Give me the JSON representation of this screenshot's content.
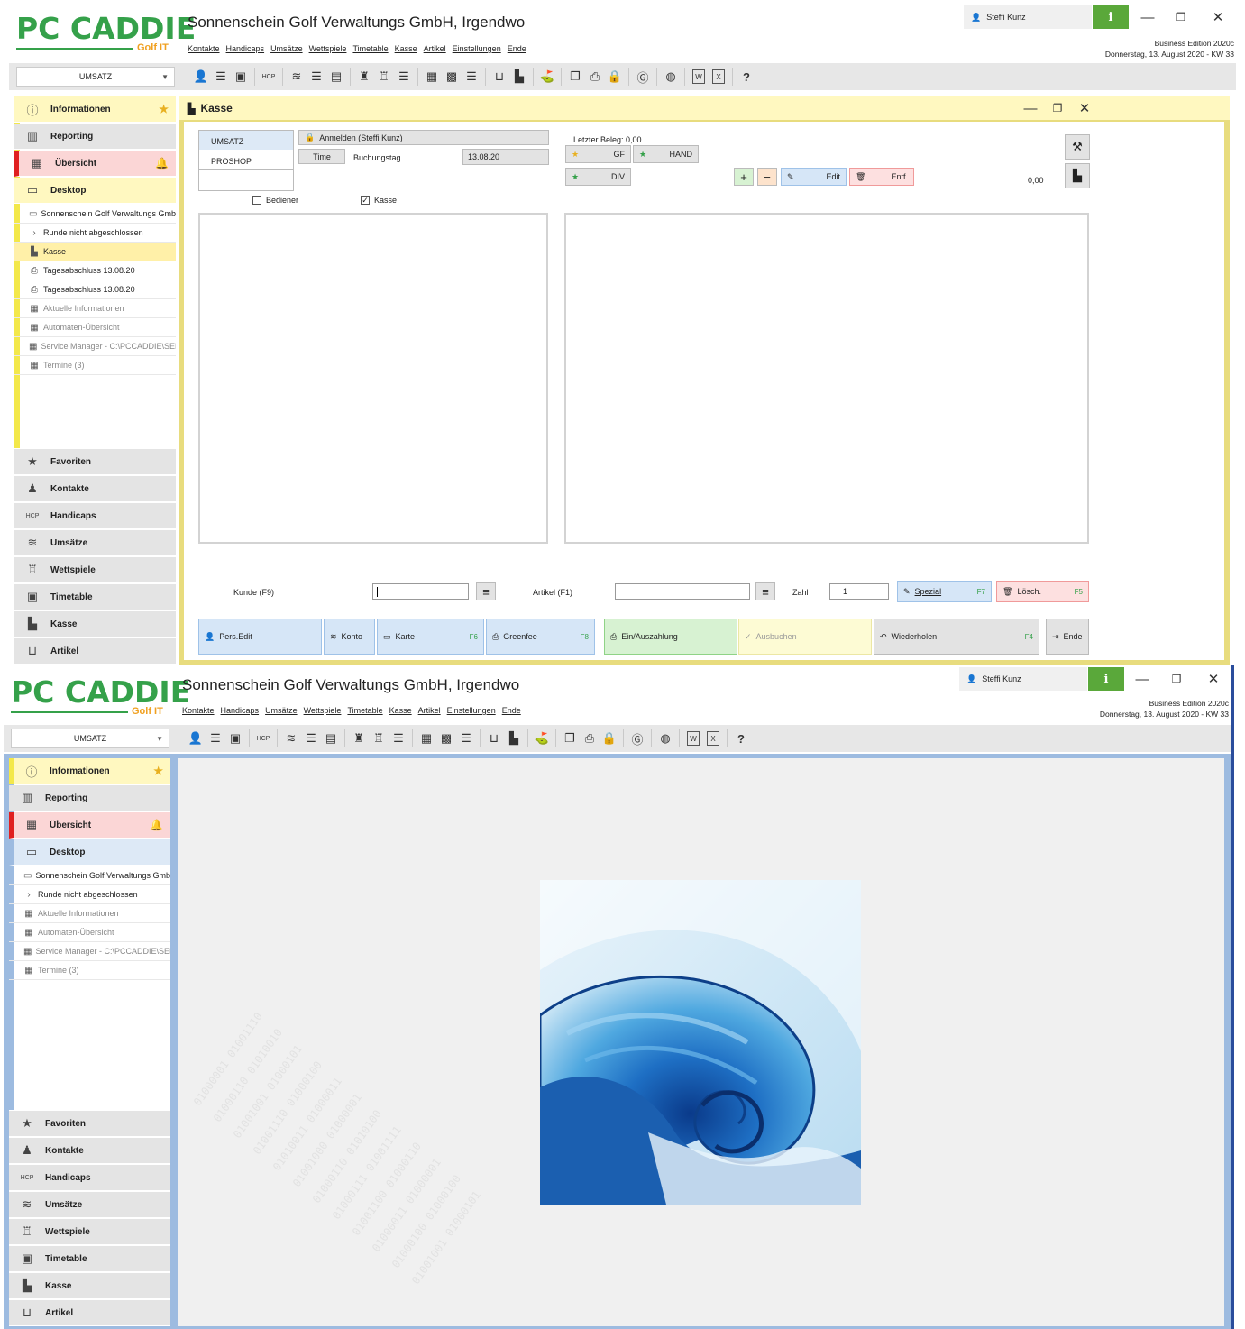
{
  "header": {
    "logo": "PC CADDIE",
    "logo_sub": "Golf IT",
    "title": "Sonnenschein Golf Verwaltungs GmbH, Irgendwo",
    "menu": [
      "Kontakte",
      "Handicaps",
      "Umsätze",
      "Wettspiele",
      "Timetable",
      "Kasse",
      "Artikel",
      "Einstellungen",
      "Ende"
    ],
    "user": "Steffi Kunz",
    "info_icon": "i",
    "edition": "Business Edition 2020c",
    "date": "Donnerstag, 13. August 2020 - KW 33",
    "window_controls": [
      "minimize-icon",
      "restore-icon",
      "close-icon"
    ]
  },
  "toolbar": {
    "combo_value": "UMSATZ",
    "icons": [
      "contact-icon",
      "list-icon",
      "card-icon",
      "sep",
      "hcp-icon",
      "sep",
      "coins-icon",
      "list-icon",
      "document-icon",
      "sep",
      "trophy-icon",
      "trophy-alt-icon",
      "list-icon",
      "sep",
      "calendar-icon",
      "calendar-person-icon",
      "list-icon",
      "sep",
      "cart-icon",
      "register-icon",
      "sep",
      "tee-icon",
      "sep",
      "window-icon",
      "print-icon",
      "lock-icon",
      "sep",
      "g-circle-icon",
      "sep",
      "globe-icon",
      "sep",
      "word-icon",
      "excel-icon",
      "sep",
      "help-icon"
    ]
  },
  "sidebar": {
    "top": [
      {
        "label": "Informationen",
        "icon": "ⓘ"
      },
      {
        "label": "Reporting",
        "icon": "▥"
      },
      {
        "label": "Übersicht",
        "icon": "▦"
      },
      {
        "label": "Desktop",
        "icon": "▭"
      }
    ],
    "sub_screen1": [
      {
        "label": "Sonnenschein Golf Verwaltungs GmbH",
        "icon": "▭"
      },
      {
        "label": "Runde nicht abgeschlossen",
        "icon": "›"
      },
      {
        "label": "Kasse",
        "icon": "▙"
      },
      {
        "label": "Tagesabschluss 13.08.20",
        "icon": "⎙"
      },
      {
        "label": "Tagesabschluss 13.08.20",
        "icon": "⎙"
      },
      {
        "label": "Aktuelle Informationen",
        "icon": "▦"
      },
      {
        "label": "Automaten-Übersicht",
        "icon": "▦"
      },
      {
        "label": "Service Manager - C:\\PCCADDIE\\SERVICE",
        "icon": "▦"
      },
      {
        "label": "Termine (3)",
        "icon": "▦"
      }
    ],
    "sub_screen2": [
      {
        "label": "Sonnenschein Golf Verwaltungs GmbH",
        "icon": "▭"
      },
      {
        "label": "Runde nicht abgeschlossen",
        "icon": "›"
      },
      {
        "label": "Aktuelle Informationen",
        "icon": "▦"
      },
      {
        "label": "Automaten-Übersicht",
        "icon": "▦"
      },
      {
        "label": "Service Manager - C:\\PCCADDIE\\SERVICE",
        "icon": "▦"
      },
      {
        "label": "Termine (3)",
        "icon": "▦"
      }
    ],
    "bottom": [
      {
        "label": "Favoriten",
        "icon": "★"
      },
      {
        "label": "Kontakte",
        "icon": "♟"
      },
      {
        "label": "Handicaps",
        "icon": "HCP"
      },
      {
        "label": "Umsätze",
        "icon": "≋"
      },
      {
        "label": "Wettspiele",
        "icon": "♖"
      },
      {
        "label": "Timetable",
        "icon": "▣"
      },
      {
        "label": "Kasse",
        "icon": "▙"
      },
      {
        "label": "Artikel",
        "icon": "⊔"
      }
    ]
  },
  "kasse": {
    "title": "Kasse",
    "tabs": [
      "UMSATZ",
      "PROSHOP"
    ],
    "login": "Anmelden (Steffi Kunz)",
    "time_label": "Time",
    "buchungstag_label": "Buchungstag",
    "buchungstag_value": "13.08.20",
    "bediener_label": "Bediener",
    "kasse_check_label": "Kasse",
    "letzter_beleg": "Letzter Beleg: 0,00",
    "quick": [
      "GF",
      "HAND",
      "DIV"
    ],
    "edit_label": "Edit",
    "entf_label": "Entf.",
    "amount": "0,00",
    "kunde_label": "Kunde (F9)",
    "artikel_label": "Artikel (F1)",
    "zahl_label": "Zahl",
    "zahl_value": "1",
    "spezial_label": "Spezial",
    "spezial_key": "F7",
    "losch_label": "Lösch.",
    "losch_key": "F5",
    "bottom_buttons": {
      "pers_edit": "Pers.Edit",
      "konto": "Konto",
      "karte": "Karte",
      "karte_key": "F6",
      "greenfee": "Greenfee",
      "greenfee_key": "F8",
      "ein_aus": "Ein/Auszahlung",
      "ausbuchen": "Ausbuchen",
      "wiederholen": "Wiederholen",
      "wiederholen_key": "F4",
      "ende": "Ende"
    }
  },
  "desktop_bg": {
    "binary_lines": [
      "01000001 01001110",
      "01000110 01010010",
      "01001001 01000101",
      "01001110 01000100",
      "01010011 01000011",
      "01001000 01000001",
      "01000110 01010100",
      "01000111 01001111",
      "01001100 01000110",
      "01000011 01000001",
      "01000100 01000100",
      "01001001 01000101"
    ]
  },
  "colors": {
    "brand_green": "#35a14a",
    "brand_orange": "#f0a020",
    "info_yellow": "#fff8c0",
    "alert_red": "#fbd6d6",
    "kasse_frame": "#e8dc7e",
    "desktop_blue": "#9dbbe0"
  }
}
